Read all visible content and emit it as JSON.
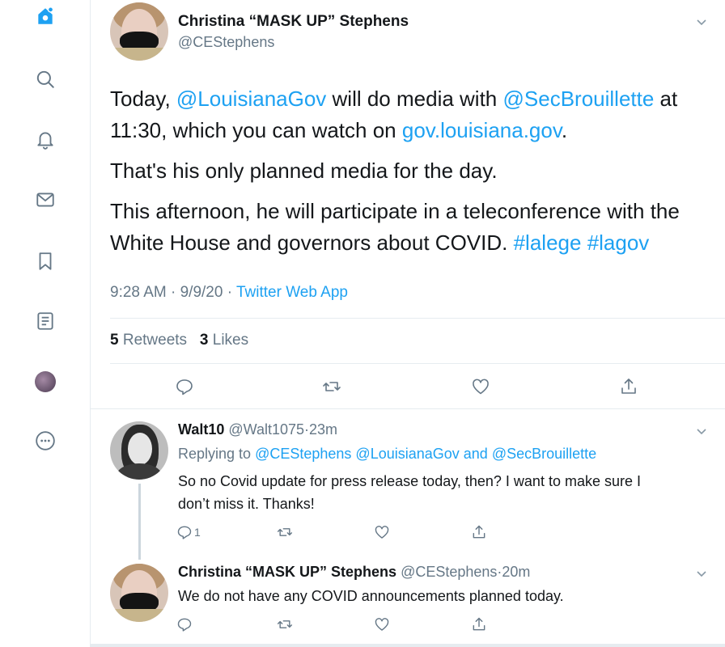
{
  "sidebar": {
    "items": [
      {
        "name": "home-icon"
      },
      {
        "name": "explore-icon"
      },
      {
        "name": "notifications-icon"
      },
      {
        "name": "messages-icon"
      },
      {
        "name": "bookmarks-icon"
      },
      {
        "name": "lists-icon"
      },
      {
        "name": "profile-avatar"
      },
      {
        "name": "more-icon"
      }
    ]
  },
  "tweet": {
    "author_name": "Christina “MASK UP” Stephens",
    "author_handle": "@CEStephens",
    "body": {
      "p1_a": "Today, ",
      "p1_mention1": "@LouisianaGov",
      "p1_b": " will do media with ",
      "p1_mention2": "@SecBrouillette",
      "p1_c": " at 11:30, which you can watch on ",
      "p1_link": "gov.louisiana.gov",
      "p1_d": ".",
      "p2": "That's his only planned media for the day.",
      "p3_a": "This afternoon, he will participate in a teleconference with the White House and governors about COVID. ",
      "p3_tag1": "#lalege",
      "p3_tag2": "#lagov"
    },
    "time": "9:28 AM",
    "sep": " · ",
    "date": "9/9/20",
    "source": "Twitter Web App",
    "retweet_count": "5",
    "retweet_label": "Retweets",
    "like_count": "3",
    "like_label": "Likes"
  },
  "replies": [
    {
      "name": "Walt10",
      "handle": "@Walt1075",
      "age": "23m",
      "replying_prefix": "Replying to ",
      "replying_1": "@CEStephens",
      "replying_2": "@LouisianaGov",
      "replying_and": " and ",
      "replying_3": "@SecBrouillette",
      "text_line1": "So no Covid update for press release today, then?  I want to make sure I",
      "text_line2": "don’t miss it. Thanks!",
      "reply_count": "1"
    },
    {
      "name": "Christina “MASK UP” Stephens",
      "handle": "@CEStephens",
      "age": "20m",
      "text_line1": "We do not have any COVID announcements planned today."
    }
  ],
  "colors": {
    "accent": "#1da1f2",
    "muted": "#657786",
    "text": "#14171a",
    "border": "#e6ecf0"
  }
}
